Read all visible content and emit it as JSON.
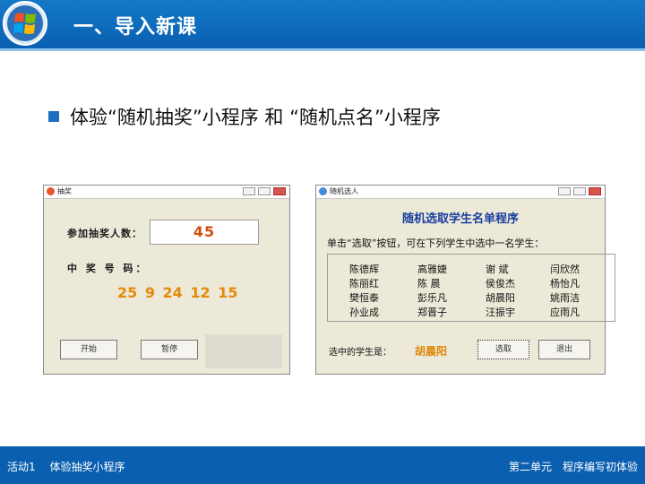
{
  "header": {
    "title": "一、导入新课"
  },
  "intro": {
    "text": "体验“随机抽奖”小程序 和 “随机点名”小程序"
  },
  "lottery_window": {
    "title": "抽奖",
    "count_label": "参加抽奖人数：",
    "count_value": "45",
    "winners_label": "中 奖 号 码：",
    "winning_numbers": "25  9  24  12  15",
    "buttons": [
      "开始",
      "暂停"
    ]
  },
  "rollcall_window": {
    "title": "随机选人",
    "heading": "随机选取学生名单程序",
    "instruction": "单击“选取”按钮，可在下列学生中选中一名学生：",
    "students": [
      "陈德辉",
      "高雅婕",
      "谢 斌",
      "闫欣然",
      "陈丽红",
      "陈 晨",
      "侯俊杰",
      "杨怡凡",
      "樊恒泰",
      "彭乐凡",
      "胡晨阳",
      "姚雨洁",
      "孙业成",
      "郑晋子",
      "汪振宇",
      "应雨凡"
    ],
    "selected_label": "选中的学生是：",
    "selected_name": "胡晨阳",
    "buttons": [
      "选取",
      "退出"
    ]
  },
  "footer": {
    "activity": "活动1　 体验抽奖小程序",
    "unit": "第二单元　程序编写初体验"
  }
}
